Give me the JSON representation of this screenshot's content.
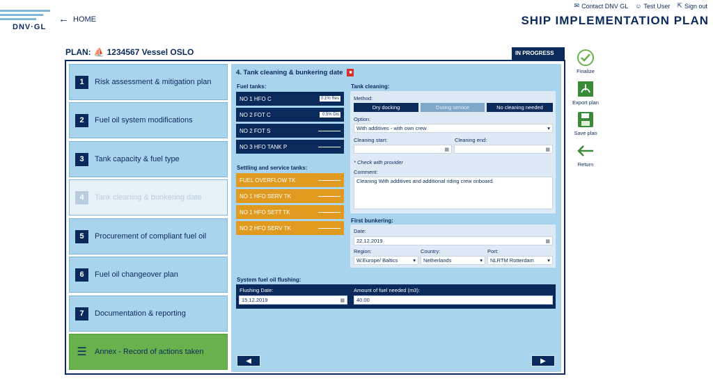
{
  "header": {
    "logo_text": "DNV·GL",
    "home": "HOME",
    "contact": "Contact DNV GL",
    "user": "Test User",
    "signout": "Sign out",
    "app_title": "SHIP IMPLEMENTATION PLAN"
  },
  "plan": {
    "label": "PLAN:",
    "vessel": "1234567 Vessel OSLO",
    "status": "IN PROGRESS"
  },
  "steps": [
    {
      "num": "1",
      "label": "Risk assessment & mitigation plan"
    },
    {
      "num": "2",
      "label": "Fuel oil system modifications"
    },
    {
      "num": "3",
      "label": "Tank capacity & fuel type"
    },
    {
      "num": "4",
      "label": "Tank cleaning & bunkering date"
    },
    {
      "num": "5",
      "label": "Procurement of compliant fuel oil"
    },
    {
      "num": "6",
      "label": "Fuel oil changeover plan"
    },
    {
      "num": "7",
      "label": "Documentation & reporting"
    },
    {
      "num": "",
      "label": "Annex - Record of actions taken"
    }
  ],
  "section": {
    "title": "4. Tank cleaning & bunkering date",
    "fuel_tanks_label": "Fuel tanks:",
    "fuel_tanks": [
      {
        "name": "NO 1 HFO C",
        "badge": "0.1% Res"
      },
      {
        "name": "NO 2 FOT C",
        "badge": "0.5% Dis"
      },
      {
        "name": "NO 2 FOT S",
        "badge": ""
      },
      {
        "name": "NO 3 HFO TANK P",
        "badge": ""
      }
    ],
    "settling_label": "Settling and service tanks:",
    "settling_tanks": [
      {
        "name": "FUEL OVERFLOW TK"
      },
      {
        "name": "NO 1 HFO SERV TK"
      },
      {
        "name": "NO 1 HFO SETT TK"
      },
      {
        "name": "NO 2 HFO SERV TK"
      }
    ],
    "tank_cleaning_label": "Tank cleaning:",
    "method_label": "Method:",
    "methods": [
      "Dry docking",
      "During service",
      "No cleaning needed"
    ],
    "option_label": "Option:",
    "option_value": "With additives - with own crew",
    "cleaning_start_label": "Cleaning start:",
    "cleaning_end_label": "Cleaning end:",
    "check_note": "* Check with provider",
    "comment_label": "Comment:",
    "comment_value": "Cleaning With additives and additional riding crew onboard.",
    "first_bunkering_label": "First bunkering:",
    "date_label": "Date:",
    "date_value": "22.12.2019",
    "region_label": "Region:",
    "region_value": "W.Europe/ Baltics",
    "country_label": "Country:",
    "country_value": "Netherlands",
    "port_label": "Port:",
    "port_value": "NLRTM Rotterdam",
    "flushing_section_label": "System fuel oil flushing:",
    "flushing_date_label": "Flushing Date:",
    "flushing_date_value": "15.12.2019",
    "fuel_amount_label": "Amount of fuel needed (m3):",
    "fuel_amount_value": "40.00"
  },
  "actions": [
    "Finalize",
    "Export plan",
    "Save plan",
    "Return"
  ],
  "colors": {
    "navy": "#0a2a5c",
    "light_blue": "#a9d4ee",
    "orange": "#e09a1f",
    "green": "#6ab04c",
    "pdf_red": "#d3302f"
  }
}
